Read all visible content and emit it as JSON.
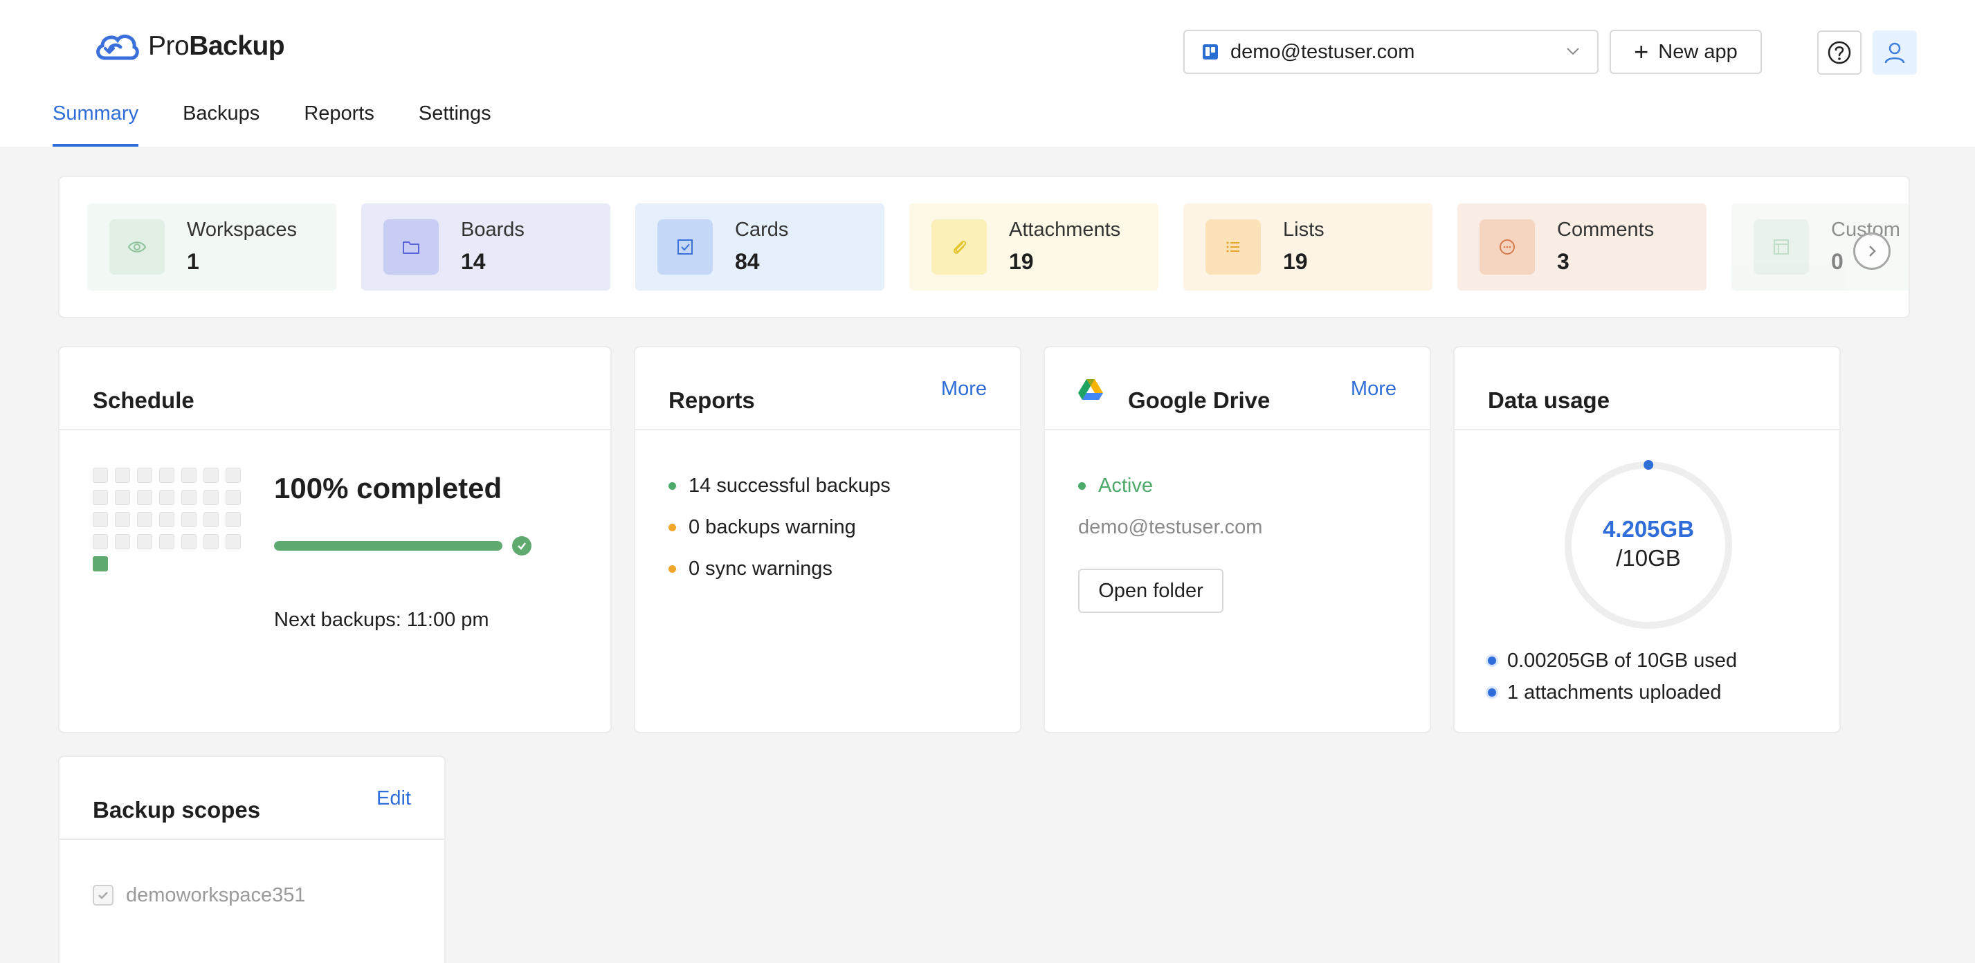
{
  "header": {
    "logo": {
      "pro": "Pro",
      "backup": "Backup"
    },
    "account": "demo@testuser.com",
    "new_app_label": "New app",
    "help_icon": "question-circle-icon",
    "user_icon": "user-icon"
  },
  "tabs": [
    {
      "label": "Summary",
      "active": true
    },
    {
      "label": "Backups",
      "active": false
    },
    {
      "label": "Reports",
      "active": false
    },
    {
      "label": "Settings",
      "active": false
    }
  ],
  "stats": [
    {
      "label": "Workspaces",
      "value": "1",
      "icon": "eye-icon",
      "bg": "#f2f8f3",
      "icon_bg": "#e1efe4",
      "icon_color": "#8fc39c"
    },
    {
      "label": "Boards",
      "value": "14",
      "icon": "folder-icon",
      "bg": "#e8eafa",
      "icon_bg": "#c8cdf4",
      "icon_color": "#5a66d8"
    },
    {
      "label": "Cards",
      "value": "84",
      "icon": "checkbox-icon",
      "bg": "#e6effc",
      "icon_bg": "#c5d8f7",
      "icon_color": "#3a72d8"
    },
    {
      "label": "Attachments",
      "value": "19",
      "icon": "paperclip-icon",
      "bg": "#fdf9e6",
      "icon_bg": "#fbf0b8",
      "icon_color": "#e5c42c"
    },
    {
      "label": "Lists",
      "value": "19",
      "icon": "list-icon",
      "bg": "#fdf4e6",
      "icon_bg": "#fbe2b8",
      "icon_color": "#e5a42c"
    },
    {
      "label": "Comments",
      "value": "3",
      "icon": "comment-icon",
      "bg": "#faede6",
      "icon_bg": "#f5d4c0",
      "icon_color": "#d77a4a"
    },
    {
      "label": "Custom",
      "value": "0",
      "icon": "layout-icon",
      "bg": "#eef5ef",
      "icon_bg": "#d7e9da",
      "icon_color": "#8fc39c"
    }
  ],
  "schedule": {
    "title": "Schedule",
    "completed_text": "100% completed",
    "progress": 1.0,
    "next_backups": "Next backups: 11:00 pm",
    "grid_total": 29,
    "grid_done_index": 29
  },
  "reports": {
    "title": "Reports",
    "more": "More",
    "items": [
      {
        "text": "14 successful backups",
        "color": "#4caa6a"
      },
      {
        "text": "0 backups warning",
        "color": "#f0a52b"
      },
      {
        "text": "0 sync warnings",
        "color": "#f0a52b"
      }
    ]
  },
  "drive": {
    "title": "Google Drive",
    "more": "More",
    "status": "Active",
    "email": "demo@testuser.com",
    "open_folder": "Open folder"
  },
  "usage": {
    "title": "Data usage",
    "value": "4.205GB",
    "total": "/10GB",
    "fraction": 0.0002,
    "items": [
      "0.00205GB of 10GB used",
      "1 attachments uploaded"
    ]
  },
  "scopes": {
    "title": "Backup scopes",
    "edit": "Edit",
    "items": [
      "demoworkspace351"
    ]
  },
  "colors": {
    "accent": "#2f6ed9",
    "success": "#4caa6a",
    "warning": "#f0a52b"
  }
}
